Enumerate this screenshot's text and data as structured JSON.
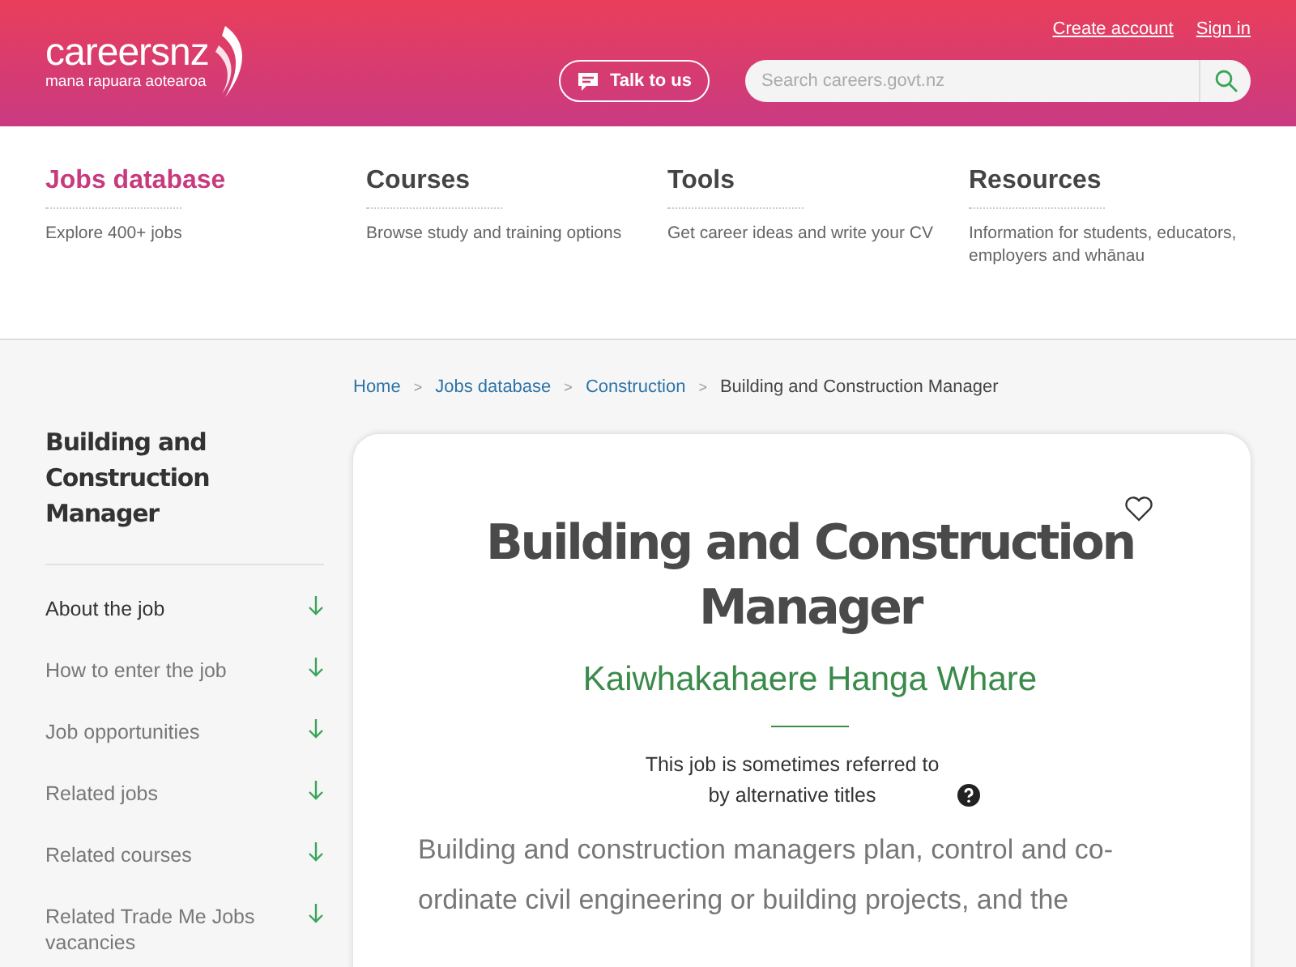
{
  "header": {
    "logo": {
      "name": "careersnz",
      "tagline": "mana rapuara aotearoa"
    },
    "links": [
      "Create account",
      "Sign in"
    ],
    "talk_button": "Talk to us",
    "search": {
      "placeholder": "Search careers.govt.nz"
    }
  },
  "nav": [
    {
      "title": "Jobs database",
      "subtitle": "Explore 400+ jobs",
      "selected": true
    },
    {
      "title": "Courses",
      "subtitle": "Browse study and training options",
      "selected": false
    },
    {
      "title": "Tools",
      "subtitle": "Get career ideas and write your CV",
      "selected": false
    },
    {
      "title": "Resources",
      "subtitle": "Information for students, educators, employers and whānau",
      "selected": false
    }
  ],
  "breadcrumb": {
    "links": [
      "Home",
      "Jobs database",
      "Construction"
    ],
    "separator": ">",
    "current": "Building and Construction Manager"
  },
  "sidebar": {
    "title": "Building and Construction Manager",
    "items": [
      {
        "label": "About the job",
        "selected": true
      },
      {
        "label": "How to enter the job",
        "selected": false
      },
      {
        "label": "Job opportunities",
        "selected": false
      },
      {
        "label": "Related jobs",
        "selected": false
      },
      {
        "label": "Related courses",
        "selected": false
      },
      {
        "label": "Related Trade Me Jobs vacancies",
        "selected": false
      }
    ]
  },
  "card": {
    "title": "Building and Construction Manager",
    "maori_title": "Kaiwhakahaere Hanga Whare",
    "alt_titles_note": "This job is sometimes referred to by alternative titles",
    "description": "Building and construction managers plan, control and co-ordinate civil engineering or building projects, and the"
  }
}
